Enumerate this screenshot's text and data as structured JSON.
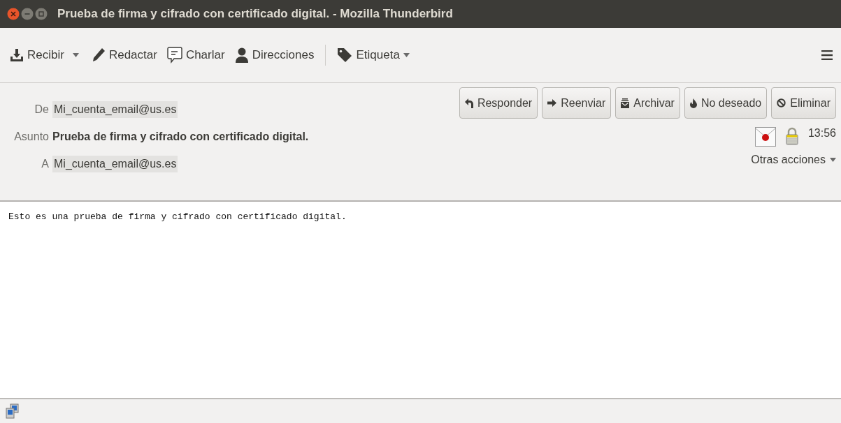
{
  "window": {
    "title": "Prueba de firma y cifrado con certificado digital. - Mozilla Thunderbird"
  },
  "toolbar": [
    {
      "label": "Recibir",
      "split_menu": true,
      "menu": false
    },
    {
      "label": "Redactar",
      "split_menu": false,
      "menu": false
    },
    {
      "label": "Charlar",
      "split_menu": false,
      "menu": false
    },
    {
      "label": "Direcciones",
      "split_menu": false,
      "menu": false
    },
    {
      "label": "Etiqueta",
      "split_menu": false,
      "menu": true
    }
  ],
  "header": {
    "fields": [
      {
        "label": "De",
        "value": "Mi_cuenta_email@us.es",
        "kind": "address"
      },
      {
        "label": "Asunto",
        "value": "Prueba de firma y cifrado con certificado digital.",
        "kind": "subject"
      },
      {
        "label": "A",
        "value": "Mi_cuenta_email@us.es",
        "kind": "address"
      }
    ],
    "actions": [
      "Responder",
      "Reenviar",
      "Archivar",
      "No deseado",
      "Eliminar"
    ],
    "time": "13:56",
    "signed": true,
    "encrypted": true,
    "more_actions": "Otras acciones"
  },
  "body": {
    "text": "Esto es una prueba de firma y cifrado con certificado digital."
  }
}
